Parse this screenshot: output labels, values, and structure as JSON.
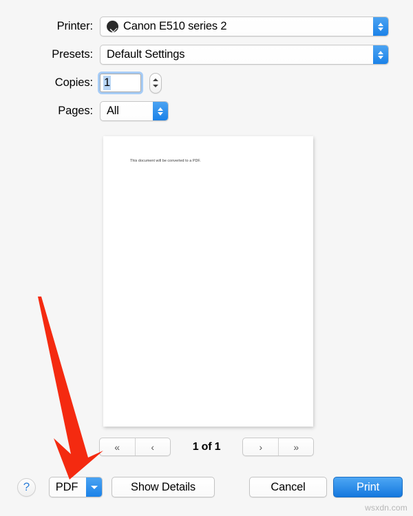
{
  "dialog": {
    "rows": [
      {
        "label": "Printer:",
        "value": "Canon E510 series 2",
        "icon": "printer-status-icon"
      },
      {
        "label": "Presets:",
        "value": "Default Settings"
      },
      {
        "label": "Copies:",
        "value": "1"
      },
      {
        "label": "Pages:",
        "value": "All"
      }
    ]
  },
  "preview": {
    "page_text": "This document will be converted to a PDF.",
    "pager": {
      "first_label": "«",
      "prev_label": "‹",
      "next_label": "›",
      "last_label": "»",
      "count_label": "1 of 1",
      "current_page": 1,
      "total_pages": 1
    }
  },
  "footer": {
    "help_label": "?",
    "pdf_label": "PDF",
    "show_details_label": "Show Details",
    "cancel_label": "Cancel",
    "print_label": "Print"
  },
  "annotation": {
    "arrow_color": "#f42a10",
    "points_to": "PDF"
  },
  "watermark": {
    "text": "wsxdn.com"
  },
  "colors": {
    "accent_blue": "#1b82e8",
    "print_button_blue": "#2f90ea",
    "arrow_red": "#f42a10",
    "background": "#f6f6f6",
    "selection_blue": "#b9d6f5"
  }
}
